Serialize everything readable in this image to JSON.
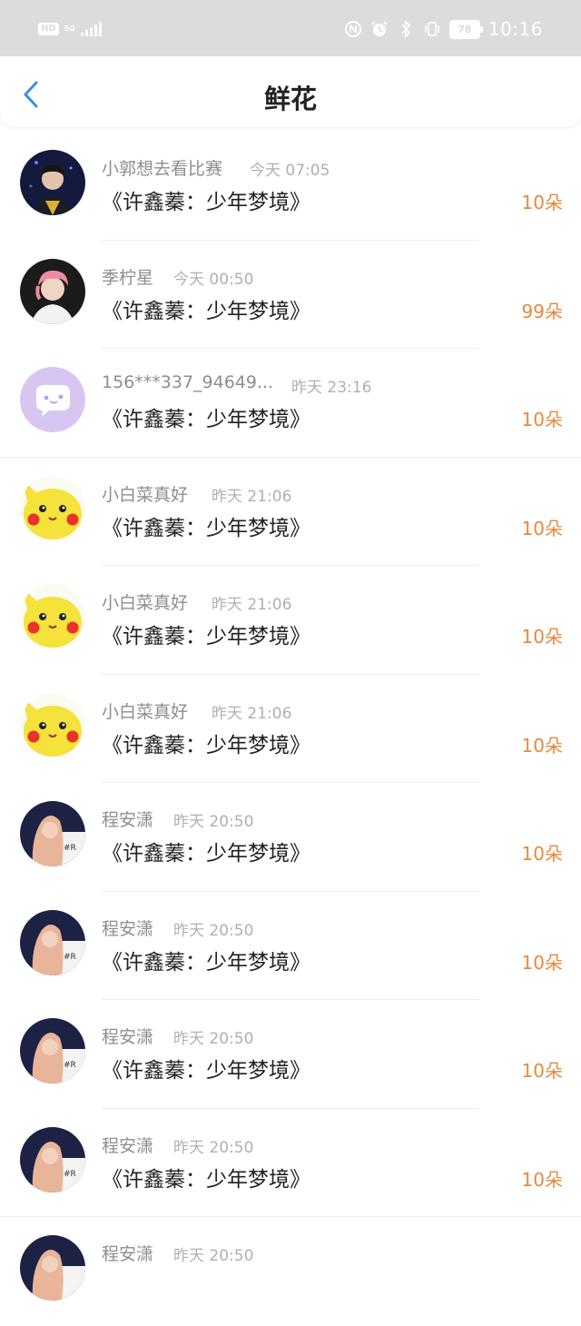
{
  "status_bar": {
    "hd_label": "HD",
    "net_label": "5G",
    "battery": "78",
    "time": "10:16"
  },
  "header": {
    "title": "鲜花"
  },
  "gifts": [
    {
      "name": "小郭想去看比赛",
      "time": "今天 07:05",
      "book": "《许鑫蓁：少年梦境》",
      "amount": "10朵",
      "avatar": "person-dark"
    },
    {
      "name": "季柠星",
      "time": "今天 00:50",
      "book": "《许鑫蓁：少年梦境》",
      "amount": "99朵",
      "avatar": "person-pink"
    },
    {
      "name": "156***337_94649...",
      "time": "昨天 23:16",
      "book": "《许鑫蓁：少年梦境》",
      "amount": "10朵",
      "avatar": "default-chat"
    },
    {
      "name": "小白菜真好",
      "time": "昨天 21:06",
      "book": "《许鑫蓁：少年梦境》",
      "amount": "10朵",
      "avatar": "pikachu"
    },
    {
      "name": "小白菜真好",
      "time": "昨天 21:06",
      "book": "《许鑫蓁：少年梦境》",
      "amount": "10朵",
      "avatar": "pikachu"
    },
    {
      "name": "小白菜真好",
      "time": "昨天 21:06",
      "book": "《许鑫蓁：少年梦境》",
      "amount": "10朵",
      "avatar": "pikachu"
    },
    {
      "name": "程安潇",
      "time": "昨天 20:50",
      "book": "《许鑫蓁：少年梦境》",
      "amount": "10朵",
      "avatar": "person-blonde"
    },
    {
      "name": "程安潇",
      "time": "昨天 20:50",
      "book": "《许鑫蓁：少年梦境》",
      "amount": "10朵",
      "avatar": "person-blonde"
    },
    {
      "name": "程安潇",
      "time": "昨天 20:50",
      "book": "《许鑫蓁：少年梦境》",
      "amount": "10朵",
      "avatar": "person-blonde"
    },
    {
      "name": "程安潇",
      "time": "昨天 20:50",
      "book": "《许鑫蓁：少年梦境》",
      "amount": "10朵",
      "avatar": "person-blonde"
    },
    {
      "name": "程安潇",
      "time": "昨天 20:50",
      "book": "",
      "amount": "",
      "avatar": "person-blonde"
    }
  ],
  "colors": {
    "accent_back": "#3a8ee6",
    "amount": "#e6893e",
    "status_bar_bg": "#dcdcdc"
  }
}
